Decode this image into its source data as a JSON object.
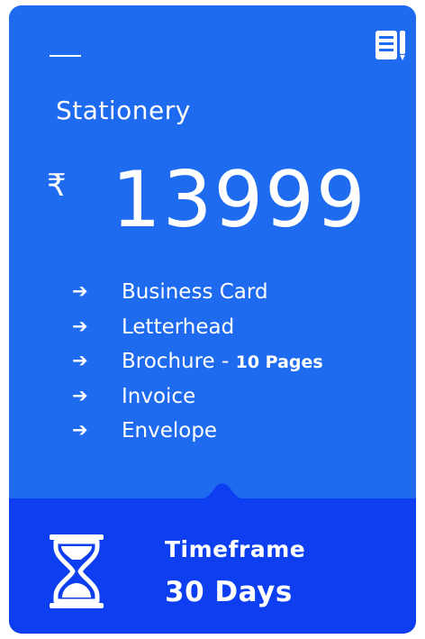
{
  "card": {
    "title": "Stationery",
    "currency_symbol": "₹",
    "price": "13999",
    "features": [
      {
        "label": "Business Card",
        "note": ""
      },
      {
        "label": "Letterhead",
        "note": ""
      },
      {
        "label": "Brochure - ",
        "note": "10 Pages"
      },
      {
        "label": "Invoice",
        "note": ""
      },
      {
        "label": "Envelope",
        "note": ""
      }
    ],
    "arrow_glyph": "➔",
    "timeframe_label": "Timeframe",
    "timeframe_value": "30 Days",
    "icons": {
      "top_right": "document-list-icon",
      "bottom": "hourglass-icon"
    },
    "colors": {
      "card_top": "#1f6bf0",
      "card_bottom": "#0d3ff0",
      "text": "#ffffff"
    }
  }
}
